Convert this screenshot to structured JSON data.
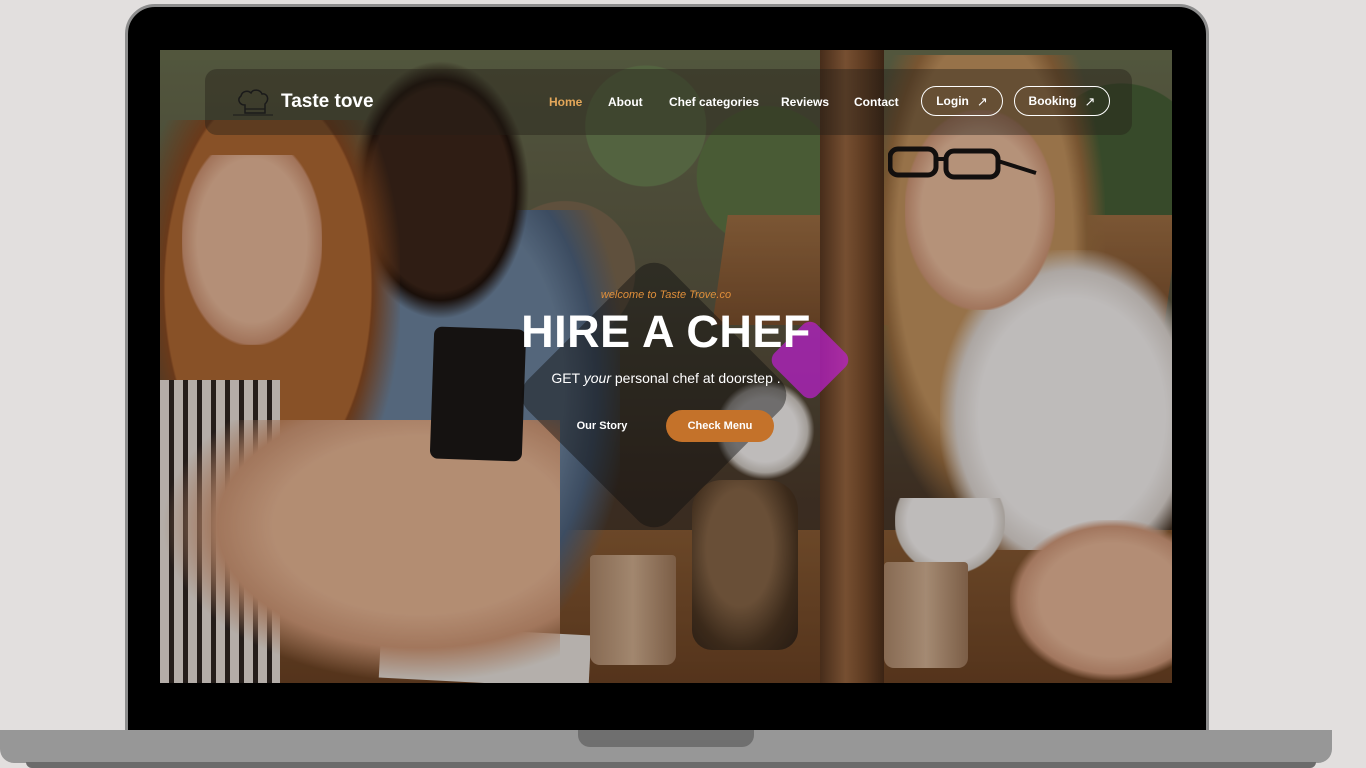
{
  "brand": {
    "name": "Taste tove",
    "logo_icon": "chef-hat-icon"
  },
  "nav": {
    "items": [
      {
        "label": "Home",
        "active": true
      },
      {
        "label": "About",
        "active": false
      },
      {
        "label": "Chef categories",
        "active": false
      },
      {
        "label": "Reviews",
        "active": false
      },
      {
        "label": "Contact",
        "active": false
      }
    ],
    "login_label": "Login",
    "booking_label": "Booking",
    "arrow_icon": "arrow-up-right-icon"
  },
  "hero": {
    "welcome": "welcome to Taste Trove.co",
    "title": "HIRE A CHEF",
    "sub_prefix": "GET",
    "sub_emphasis": "your",
    "sub_suffix": "personal chef at doorstep .",
    "story_label": "Our Story",
    "menu_label": "Check Menu"
  },
  "colors": {
    "accent": "#c4722a",
    "active_nav": "#e4a75a",
    "welcome_text": "#e08f3a"
  }
}
